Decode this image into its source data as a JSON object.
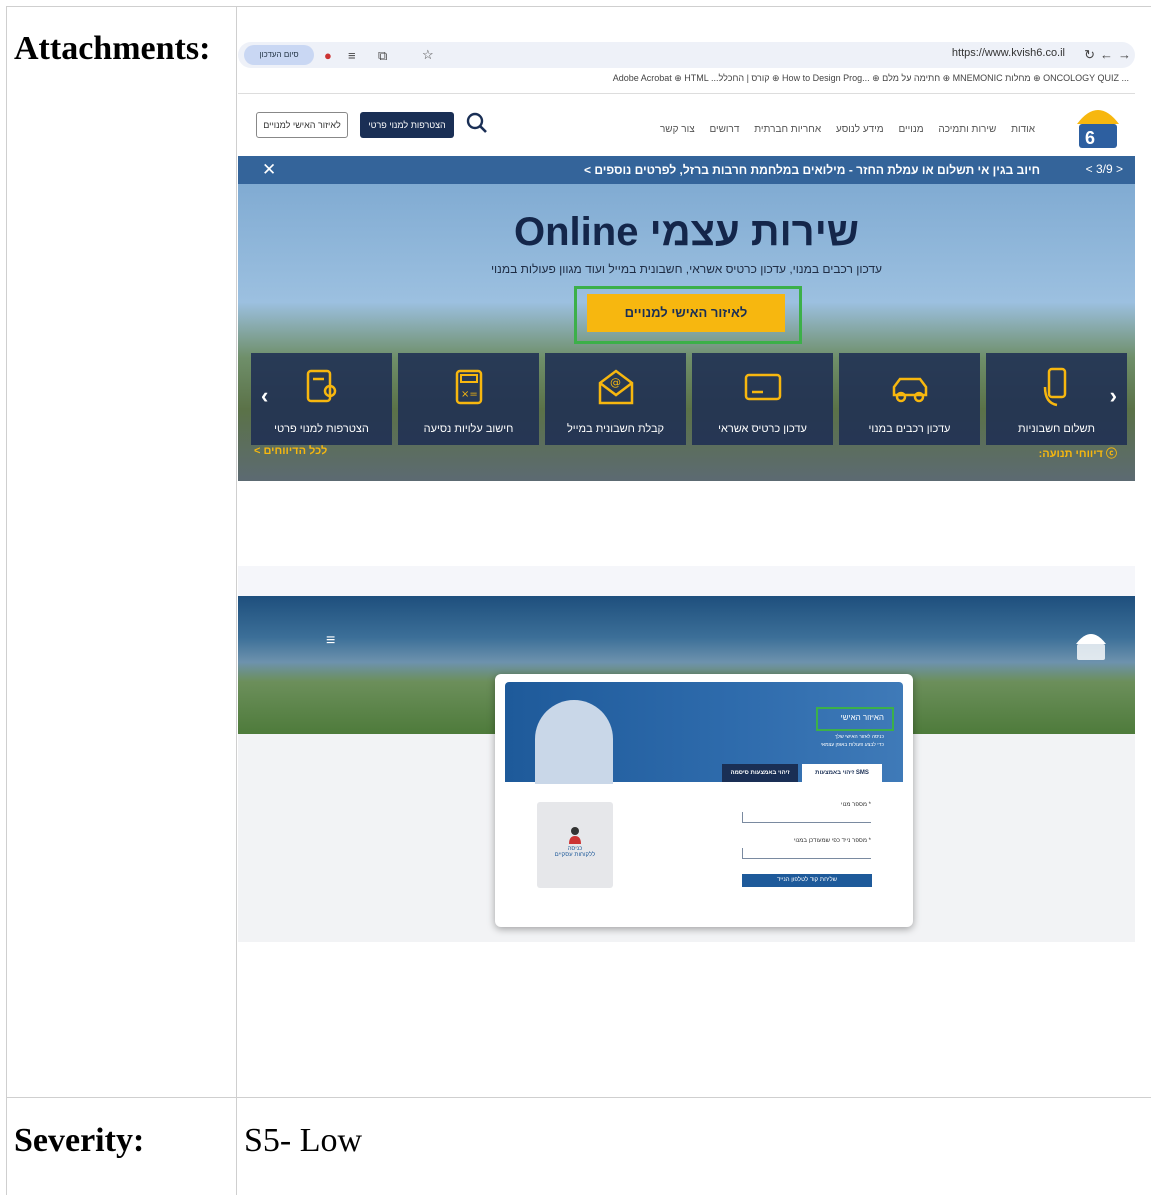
{
  "doc": {
    "attachments_label": "Attachments:",
    "severity_label": "Severity:",
    "severity_value": "S5- Low"
  },
  "shot1": {
    "browser": {
      "url": "https://www.kvish6.co.il",
      "tab_pill": "סיום העדכון",
      "bookmarks": "Adobe Acrobat ⊕ HTML ...קורס | החכלל ⊕ How to Design Prog... ⊕ חתימה על מלם ⊕ MNEMONIC מחלות ⊕ ONCOLOGY QUIZ ..."
    },
    "nav": {
      "links": [
        "אודות",
        "שירות ותמיכה",
        "מנויים",
        "מידע לנוסע",
        "אחריות חברתית",
        "דרושים",
        "צור קשר"
      ],
      "join_button": "הצטרפות למנוי פרטי",
      "area_button": "לאיזור האישי למנויים"
    },
    "ticker": {
      "text": "חיוב בגין אי תשלום או עמלת החזר - מילואים במלחמת חרבות ברזל, לפרטים נוספים >",
      "pager": "< 3/9 >",
      "close": "✕"
    },
    "hero": {
      "title": "שירות עצמי Online",
      "subtitle": "עדכון רכבים במנוי, עדכון כרטיס אשראי, חשבונית במייל ועוד מגוון פעולות במנוי",
      "cta": "לאיזור האישי למנויים"
    },
    "tiles": [
      "תשלום חשבוניות",
      "עדכון רכבים במנוי",
      "עדכון כרטיס אשראי",
      "קבלת חשבונית במייל",
      "חישוב עלויות נסיעה",
      "הצטרפות למנוי פרטי"
    ],
    "footer_right": "ⓒ דיווחי תנועה:",
    "footer_left": "לכל הדיווחים >"
  },
  "shot2": {
    "card": {
      "title": "האיזור האישי",
      "line1": "כניסה לאזור האישי שלך",
      "line2": "כדי לבצע פעולות באופן עצמאי",
      "tab_sms": "זיהוי באמצעות SMS",
      "tab_pass": "זיהוי באמצעות סיסמה",
      "field1": "* מספר מנוי",
      "field2": "* מספר נייד כפי שמעודכן במנוי",
      "submit": "שליחת קוד לטלפון הנייד",
      "biz_line1": "כניסה",
      "biz_line2": "ללקוחות עסקיים"
    }
  },
  "colors": {
    "brand_dark": "#1a2f55",
    "brand_yellow": "#f7b70f",
    "highlight_green": "#3cb049"
  }
}
